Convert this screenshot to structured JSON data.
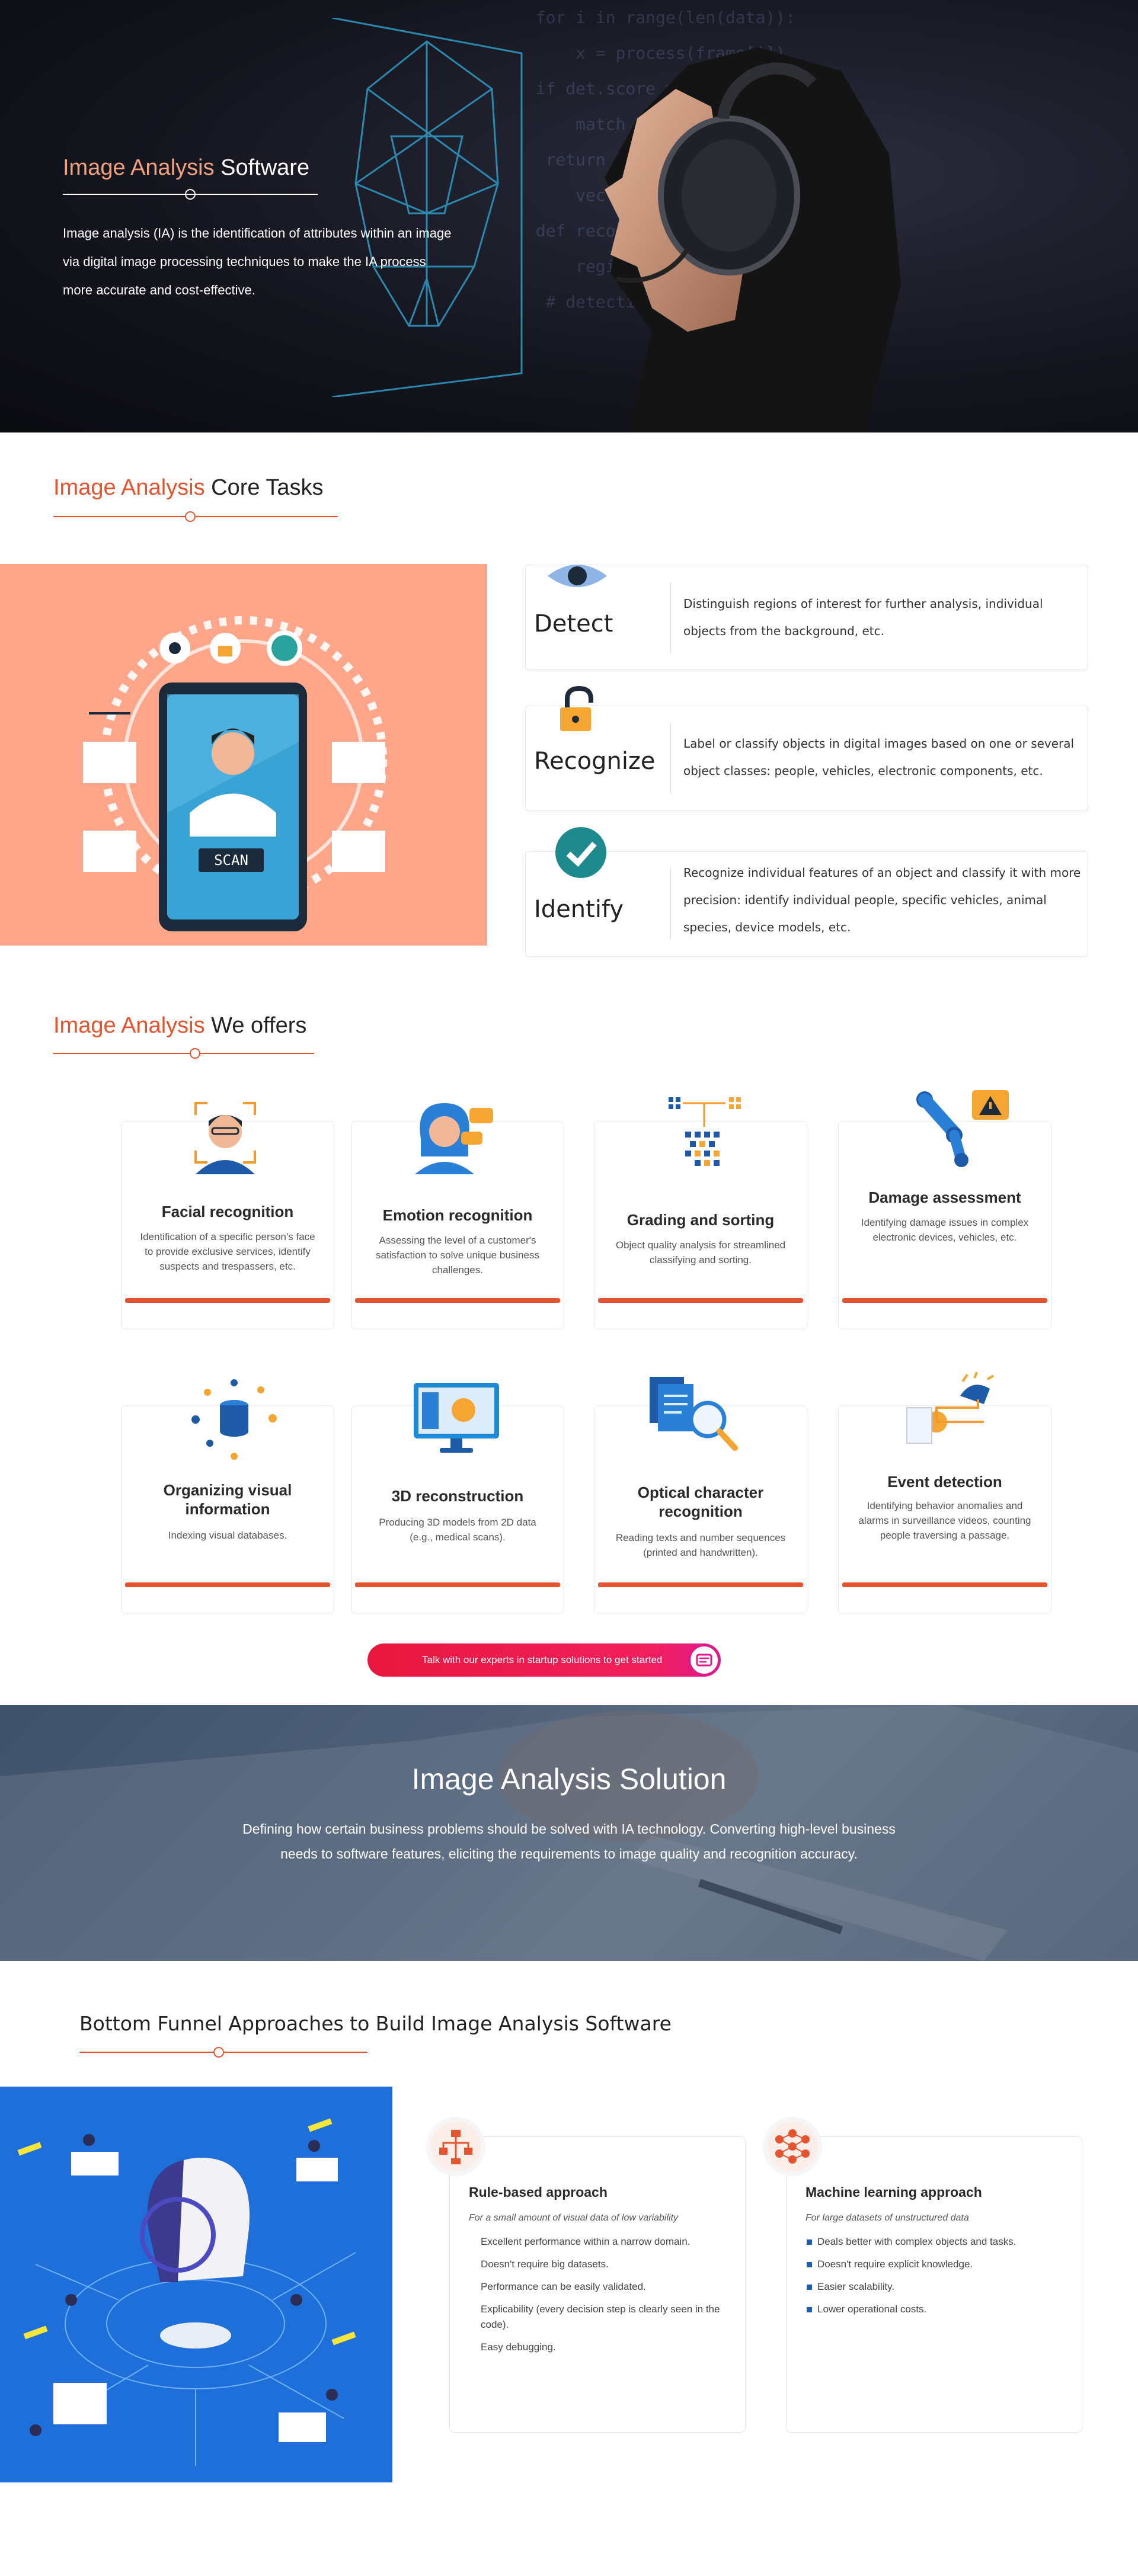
{
  "hero": {
    "title_accent": "Image Analysis",
    "title_rest": " Software",
    "description": "Image analysis (IA) is the identification of attributes within an image via digital image processing techniques to make the IA process more accurate and cost-effective."
  },
  "core_tasks": {
    "title_accent": "Image Analysis",
    "title_rest": " Core Tasks",
    "illustration_label": "SCAN",
    "tasks": [
      {
        "name": "Detect",
        "icon": "eye-icon",
        "description": "Distinguish regions of interest for further analysis, individual objects from the background, etc."
      },
      {
        "name": "Recognize",
        "icon": "padlock-icon",
        "description": "Label or classify objects in digital images based on one or several object classes: people, vehicles, electronic components, etc."
      },
      {
        "name": "Identify",
        "icon": "checkmark-icon",
        "description": "Recognize individual features of an object and classify it with more precision: identify individual people, specific vehicles, animal species, device models, etc."
      }
    ]
  },
  "offers": {
    "title_accent": "Image Analysis",
    "title_rest": " We offers",
    "items": [
      {
        "title": "Facial recognition",
        "icon": "face-scan-icon",
        "description": "Identification of a specific person's face to provide exclusive services, identify suspects and trespassers, etc."
      },
      {
        "title": "Emotion recognition",
        "icon": "emotion-icon",
        "description": "Assessing the level of a customer's satisfaction to solve unique business challenges."
      },
      {
        "title": "Grading and sorting",
        "icon": "sorting-grid-icon",
        "description": "Object quality analysis for streamlined classifying and sorting."
      },
      {
        "title": "Damage assessment",
        "icon": "robot-arm-warning-icon",
        "description": "Identifying damage issues in complex electronic devices, vehicles, etc."
      },
      {
        "title": "Organizing visual information",
        "icon": "database-icon",
        "description": "Indexing visual databases."
      },
      {
        "title": "3D reconstruction",
        "icon": "monitor-3d-icon",
        "description": "Producing 3D models from 2D data (e.g., medical scans)."
      },
      {
        "title": "Optical character recognition",
        "icon": "document-magnifier-icon",
        "description": "Reading texts and number sequences (printed and handwritten)."
      },
      {
        "title": "Event detection",
        "icon": "camera-alarm-icon",
        "description": "Identifying behavior anomalies and alarms in surveillance videos, counting people traversing a passage."
      }
    ],
    "cta_label": "Talk with our experts in startup solutions to get started"
  },
  "solution": {
    "title": "Image Analysis Solution",
    "description": "Defining how certain business problems should be solved with IA technology. Converting high-level business needs to software features, eliciting the requirements to image quality and recognition accuracy."
  },
  "funnel": {
    "title": "Bottom Funnel Approaches to Build Image Analysis Software",
    "approaches": [
      {
        "title": "Rule-based approach",
        "subtitle": "For a small amount of visual data of low variability",
        "icon": "flowchart-icon",
        "points": [
          "Excellent performance within a narrow domain.",
          "Doesn't require big datasets.",
          "Performance can be easily validated.",
          "Explicability (every decision step is clearly seen in the code).",
          "Easy debugging."
        ]
      },
      {
        "title": "Machine learning approach",
        "subtitle": "For large datasets of unstructured data",
        "icon": "neural-network-icon",
        "points": [
          "Deals better with complex objects and tasks.",
          "Doesn't require explicit knowledge.",
          "Easier scalability.",
          "Lower operational costs."
        ]
      }
    ]
  },
  "colors": {
    "accent": "#e5532f",
    "cta_start": "#e8183e",
    "cta_end": "#e0198a",
    "task_illustration_bg": "#ffa68a",
    "funnel_illustration_bg": "#1e6fd9"
  }
}
